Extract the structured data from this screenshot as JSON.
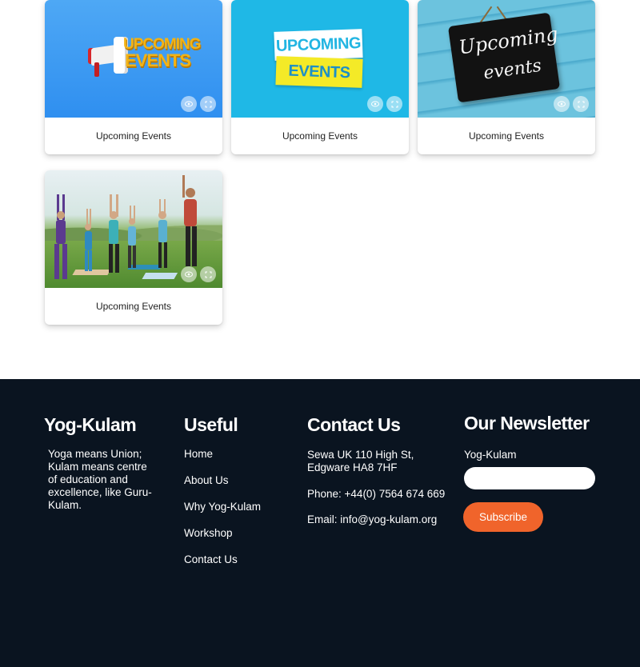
{
  "gallery": {
    "items": [
      {
        "caption": "Upcoming Events",
        "image_text_line1": "UPCOMING",
        "image_text_line2": "EVENTS"
      },
      {
        "caption": "Upcoming Events",
        "image_text_line1": "UPCOMING",
        "image_text_line2": "EVENTS"
      },
      {
        "caption": "Upcoming Events",
        "image_text_line1": "Upcoming",
        "image_text_line2": "events"
      },
      {
        "caption": "Upcoming Events"
      }
    ],
    "controls": {
      "view_icon": "eye-icon",
      "expand_icon": "expand-icon"
    }
  },
  "footer": {
    "about": {
      "title": "Yog-Kulam",
      "text": "Yoga means Union; Kulam means centre of education and excellence, like Guru-Kulam."
    },
    "useful": {
      "title": "Useful",
      "links": [
        "Home",
        "About Us",
        "Why Yog-Kulam",
        "Workshop",
        "Contact Us"
      ]
    },
    "contact": {
      "title": "Contact Us",
      "address": "Sewa UK 110 High St, Edgware HA8 7HF",
      "phone": "Phone: +44(0) 7564 674 669",
      "email": "Email: info@yog-kulam.org"
    },
    "newsletter": {
      "title": "Our Newsletter",
      "label": "Yog-Kulam",
      "input_value": "",
      "button_label": "Subscribe"
    }
  },
  "colors": {
    "footer_bg": "#0a1420",
    "accent": "#f0642b"
  }
}
